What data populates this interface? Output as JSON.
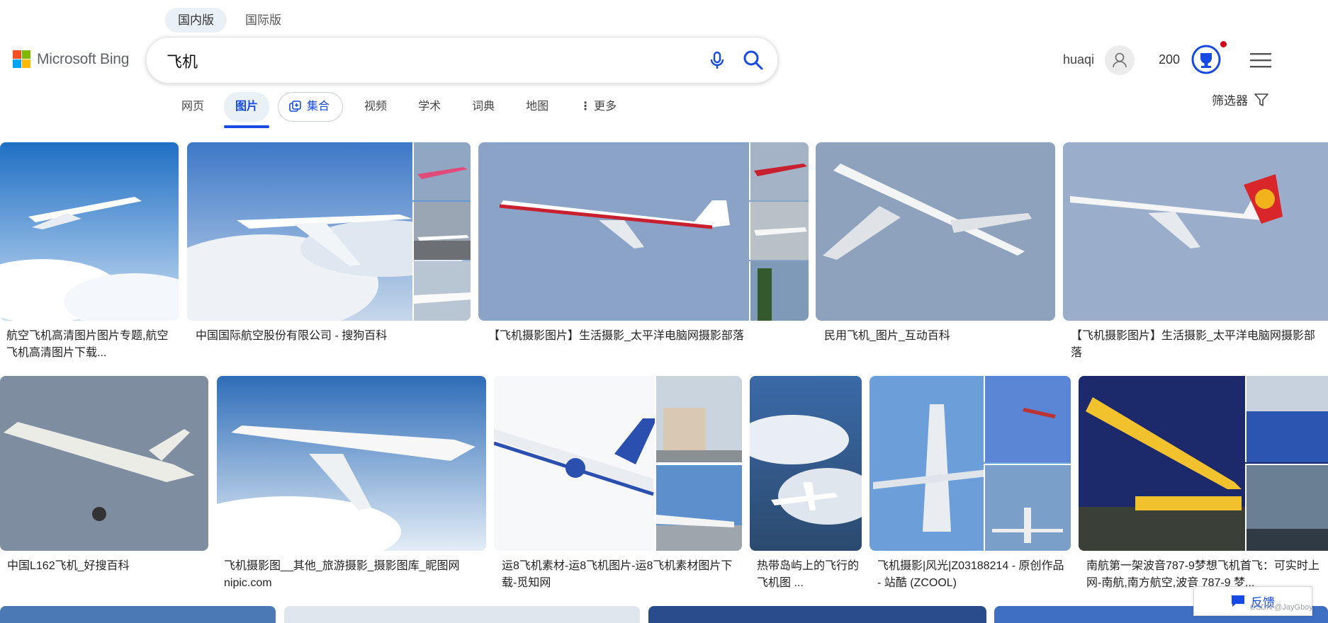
{
  "region_tabs": [
    {
      "label": "国内版",
      "active": true
    },
    {
      "label": "国际版",
      "active": false
    }
  ],
  "logo": {
    "text": "Microsoft Bing"
  },
  "search": {
    "value": "飞机"
  },
  "user": {
    "name": "huaqi",
    "points": "200"
  },
  "nav": {
    "web": "网页",
    "images": "图片",
    "collections": "集合",
    "video": "视频",
    "academic": "学术",
    "dictionary": "词典",
    "maps": "地图",
    "more": "更多"
  },
  "filter": {
    "label": "筛选器"
  },
  "results": {
    "row1": [
      {
        "caption": "航空飞机高清图片图片专题,航空飞机高清图片下载..."
      },
      {
        "caption": "中国国际航空股份有限公司 - 搜狗百科"
      },
      {
        "caption": "【飞机摄影图片】生活摄影_太平洋电脑网摄影部落"
      },
      {
        "caption": "民用飞机_图片_互动百科"
      },
      {
        "caption": "【飞机摄影图片】生活摄影_太平洋电脑网摄影部落"
      }
    ],
    "row2": [
      {
        "caption": "中国L162飞机_好搜百科"
      },
      {
        "caption": "飞机摄影图__其他_旅游摄影_摄影图库_昵图网nipic.com"
      },
      {
        "caption": "运8飞机素材-运8飞机图片-运8飞机素材图片下载-觅知网"
      },
      {
        "caption": "热带岛屿上的飞行的飞机图 ..."
      },
      {
        "caption": "飞机摄影|风光|Z03188214 - 原创作品 - 站酷 (ZCOOL)"
      },
      {
        "caption": "南航第一架波音787-9梦想飞机首飞：可实时上网-南航,南方航空,波音 787-9 梦..."
      }
    ]
  },
  "feedback": {
    "label": "反馈"
  },
  "watermark": "CSDN @JayGboy",
  "colors": {
    "accent": "#174ae4",
    "sky": "#9bbbe0",
    "active_tab_bg": "#e9f0f6",
    "notification": "#d0021b"
  }
}
